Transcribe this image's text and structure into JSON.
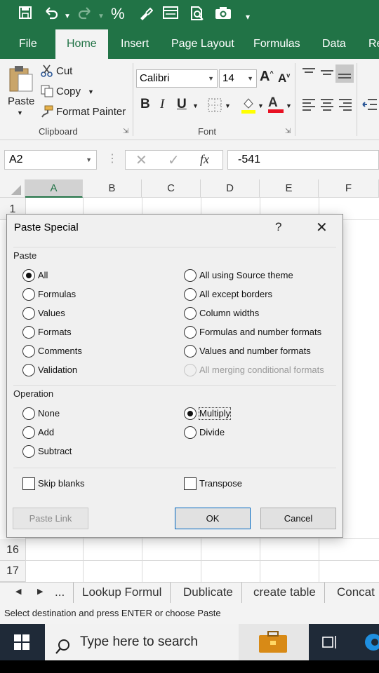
{
  "quick_access": {
    "percent": "%"
  },
  "tabs": [
    "File",
    "Home",
    "Insert",
    "Page Layout",
    "Formulas",
    "Data",
    "Re"
  ],
  "ribbon": {
    "paste_label": "Paste",
    "cut_label": "Cut",
    "copy_label": "Copy",
    "format_painter_label": "Format Painter",
    "clipboard_group": "Clipboard",
    "font_name": "Calibri",
    "font_size": "14",
    "font_group": "Font",
    "bold": "B",
    "italic": "I",
    "underline": "U"
  },
  "formula_bar": {
    "name_box": "A2",
    "fx": "fx",
    "value": "-541"
  },
  "columns": [
    "A",
    "B",
    "C",
    "D",
    "E",
    "F"
  ],
  "rows": [
    "1",
    "16",
    "17"
  ],
  "sheet_tabs": [
    "...",
    "Lookup Formul",
    "Dublicate",
    "create table",
    "Concat F"
  ],
  "status_text": "Select destination and press ENTER or choose Paste",
  "taskbar": {
    "search_placeholder": "Type here to search"
  },
  "dialog": {
    "title": "Paste Special",
    "help": "?",
    "paste_section": "Paste",
    "paste_left": [
      "All",
      "Formulas",
      "Values",
      "Formats",
      "Comments",
      "Validation"
    ],
    "paste_right": [
      "All using Source theme",
      "All except borders",
      "Column widths",
      "Formulas and number formats",
      "Values and number formats",
      "All merging conditional formats"
    ],
    "operation_section": "Operation",
    "operation_left": [
      "None",
      "Add",
      "Subtract"
    ],
    "operation_right": [
      "Multiply",
      "Divide"
    ],
    "skip_blanks": "Skip blanks",
    "transpose": "Transpose",
    "paste_link": "Paste Link",
    "ok": "OK",
    "cancel": "Cancel"
  },
  "colors": {
    "excel_green": "#217346",
    "taskbar": "#1f2a38"
  }
}
